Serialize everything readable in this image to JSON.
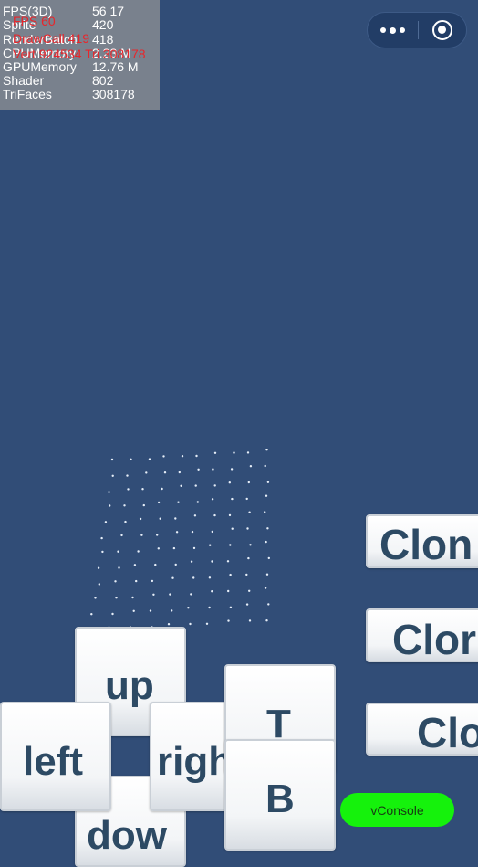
{
  "stats": [
    {
      "label": "FPS(3D)",
      "value": "56 17"
    },
    {
      "label": "Sprite",
      "value": "420"
    },
    {
      "label": "RenderBatch",
      "value": "418"
    },
    {
      "label": "CPUMemory",
      "value": "2.23 M"
    },
    {
      "label": "GPUMemory",
      "value": "12.76 M"
    },
    {
      "label": "Shader",
      "value": "802"
    },
    {
      "label": "TriFaces",
      "value": "308178"
    }
  ],
  "overlay": {
    "fps": "FPS 60",
    "draw_call": "DrawCall 419",
    "vertices": "Vert 924534 Tri 308178"
  },
  "capsule": {
    "more_icon": "more-dots-icon",
    "close_icon": "target-circle-icon"
  },
  "buttons": {
    "up": "up",
    "left": "left",
    "right": "righ",
    "down": "dow",
    "top": "T",
    "bottom": "B",
    "clone1": "Clon",
    "clone2": "Clor",
    "clone3": "Clo"
  },
  "vconsole": "vConsole",
  "colors": {
    "background": "#314d77",
    "button_text": "#2d4a64",
    "vconsole_bg": "#15f20c",
    "overlay_red": "#e8262b"
  }
}
